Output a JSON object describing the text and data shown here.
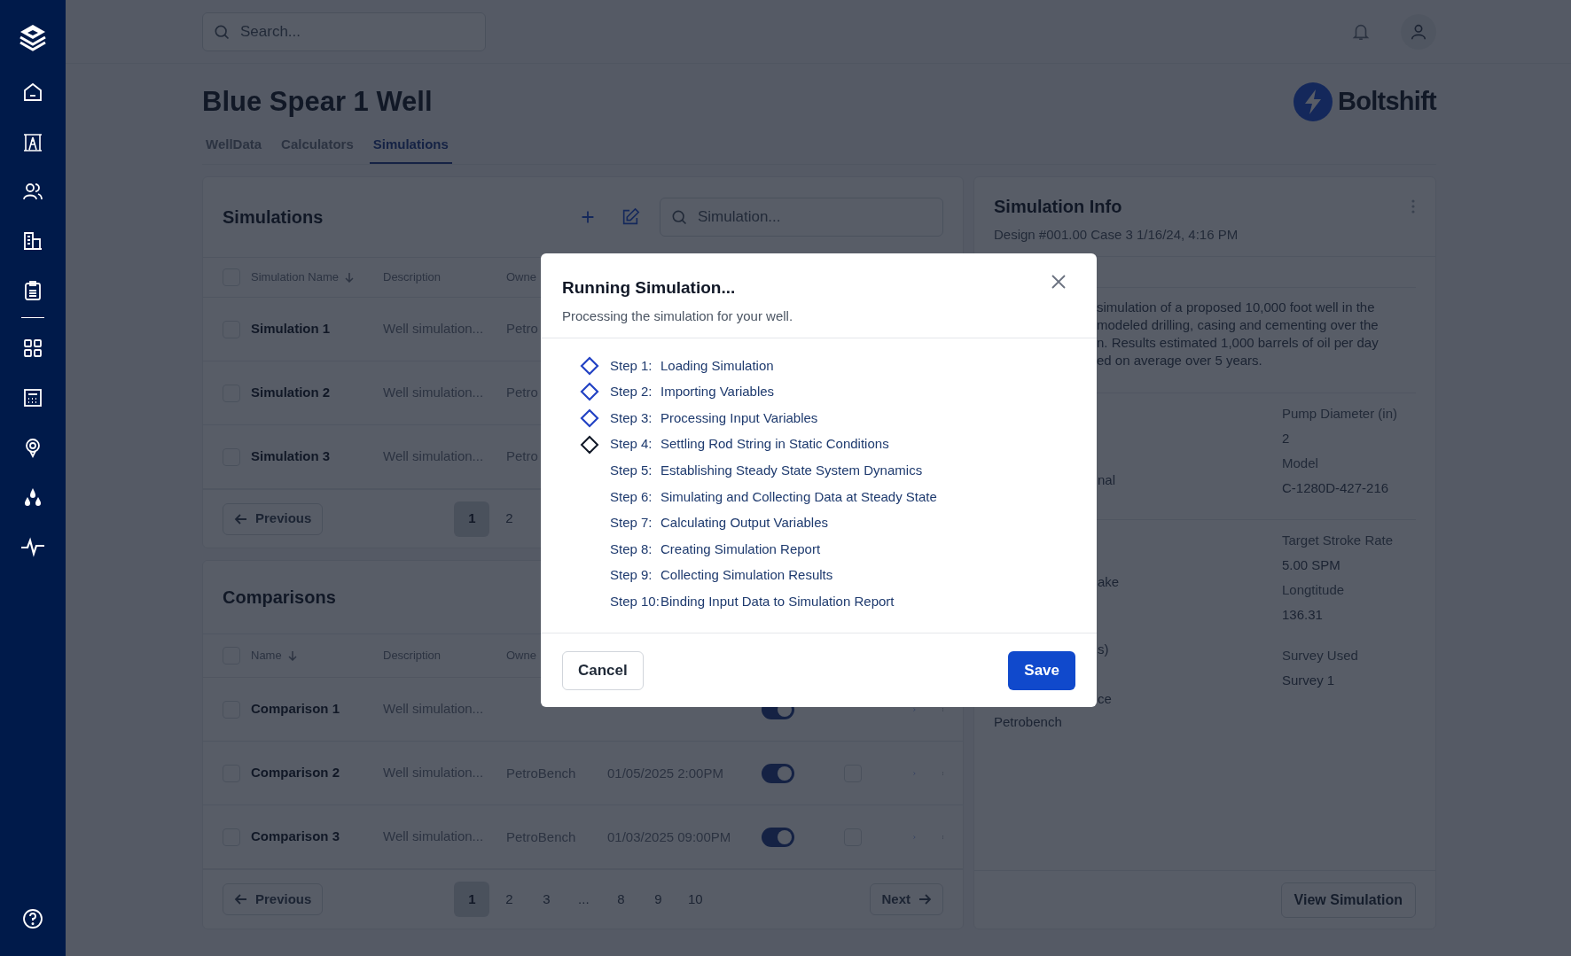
{
  "header": {
    "search": {
      "placeholder": "Search..."
    }
  },
  "page": {
    "title": "Blue Spear 1 Well",
    "brand": "Boltshift"
  },
  "tabs": [
    {
      "label": "WellData",
      "selected": false
    },
    {
      "label": "Calculators",
      "selected": false
    },
    {
      "label": "Simulations",
      "selected": true
    }
  ],
  "simulations": {
    "title": "Simulations",
    "search": {
      "placeholder": "Simulation..."
    },
    "all_checked": false,
    "columns": [
      {
        "label": "Simulation Name",
        "sorted": true
      },
      {
        "label": "Description",
        "sorted": false
      },
      {
        "label": "Owne",
        "sorted": false
      }
    ],
    "rows": [
      {
        "name": "Simulation 1",
        "description": "Well simulation...",
        "owner": "Petro",
        "checked": false
      },
      {
        "name": "Simulation 2",
        "description": "Well simulation...",
        "owner": "Petro",
        "checked": false
      },
      {
        "name": "Simulation 3",
        "description": "Well simulation...",
        "owner": "Petro",
        "checked": false
      }
    ],
    "pagination": {
      "previous": "Previous",
      "pages": [
        {
          "label": "1",
          "selected": true
        },
        {
          "label": "2",
          "selected": false
        }
      ]
    }
  },
  "comparisons": {
    "title": "Comparisons",
    "all_checked": false,
    "columns": [
      {
        "label": "Name",
        "sorted": true
      },
      {
        "label": "Description",
        "sorted": false
      },
      {
        "label": "Owne",
        "sorted": false
      }
    ],
    "rows": [
      {
        "name": "Comparison 1",
        "description": "Well simulation...",
        "checked": false,
        "on": true
      },
      {
        "name": "Comparison 2",
        "description": "Well simulation...",
        "owner": "PetroBench",
        "date": "01/05/2025 2:00PM",
        "checked": false,
        "on": true,
        "flagged": false
      },
      {
        "name": "Comparison 3",
        "description": "Well simulation...",
        "owner": "PetroBench",
        "date": "01/03/2025 09:00PM",
        "checked": false,
        "on": true,
        "flagged": false
      }
    ],
    "pagination": {
      "previous": "Previous",
      "pages": [
        {
          "label": "1",
          "selected": true
        },
        {
          "label": "2",
          "selected": false
        },
        {
          "label": "3",
          "selected": false
        },
        {
          "label": "...",
          "selected": false
        },
        {
          "label": "8",
          "selected": false
        },
        {
          "label": "9",
          "selected": false
        },
        {
          "label": "10",
          "selected": false
        }
      ],
      "next": "Next"
    }
  },
  "simulation_info": {
    "title": "Simulation Info",
    "subtitle": "Design #001.00 Case 3 1/16/24, 4:16 PM",
    "description_lines": [
      "simulation of a proposed 10,000 foot well in the",
      "modeled drilling, casing and cementing over the",
      "n. Results estimated 1,000 barrels of oil per day",
      "ed on average over 5 years."
    ],
    "sections": [
      {
        "fields": [
          {
            "label": "Pump Diameter (in)",
            "value": "2"
          },
          {
            "label": "Model",
            "value": "C-1280D-427-216"
          }
        ],
        "fragments": [
          {
            "text": "nal",
            "kind": "cut"
          }
        ]
      },
      {
        "fields": [
          {
            "label": "Target Stroke Rate",
            "value": "5.00 SPM"
          },
          {
            "label": "Longtitude",
            "value": "136.31"
          },
          {
            "label": "Survey Used",
            "value": "Survey 1"
          }
        ],
        "fragments": [
          {
            "text": "ake",
            "kind": "cut"
          },
          {
            "text": "s)",
            "kind": "cut"
          },
          {
            "text": "ce",
            "kind": "cut"
          },
          {
            "text": "Petrobench",
            "kind": "value"
          }
        ]
      }
    ],
    "button": "View Simulation"
  },
  "modal": {
    "title": "Running Simulation...",
    "subtitle": "Processing the simulation for your well.",
    "steps": [
      {
        "label": "Step 1:",
        "text": "Loading Simulation",
        "completed": true,
        "active": false
      },
      {
        "label": "Step 2:",
        "text": "Importing Variables",
        "completed": true,
        "active": false
      },
      {
        "label": "Step 3:",
        "text": "Processing Input Variables",
        "completed": true,
        "active": false
      },
      {
        "label": "Step 4:",
        "text": "Settling Rod String in Static Conditions",
        "completed": false,
        "active": true
      },
      {
        "label": "Step 5:",
        "text": "Establishing Steady State System Dynamics",
        "completed": false,
        "active": false
      },
      {
        "label": "Step 6:",
        "text": "Simulating and Collecting Data at Steady State",
        "completed": false,
        "active": false
      },
      {
        "label": "Step 7:",
        "text": "Calculating Output Variables",
        "completed": false,
        "active": false
      },
      {
        "label": "Step 8:",
        "text": "Creating Simulation Report",
        "completed": false,
        "active": false
      },
      {
        "label": "Step 9:",
        "text": "Collecting Simulation Results",
        "completed": false,
        "active": false
      },
      {
        "label": "Step 10:",
        "text": "Binding Input Data to Simulation Report",
        "completed": false,
        "active": false
      }
    ],
    "cancel": "Cancel",
    "save": "Save"
  }
}
